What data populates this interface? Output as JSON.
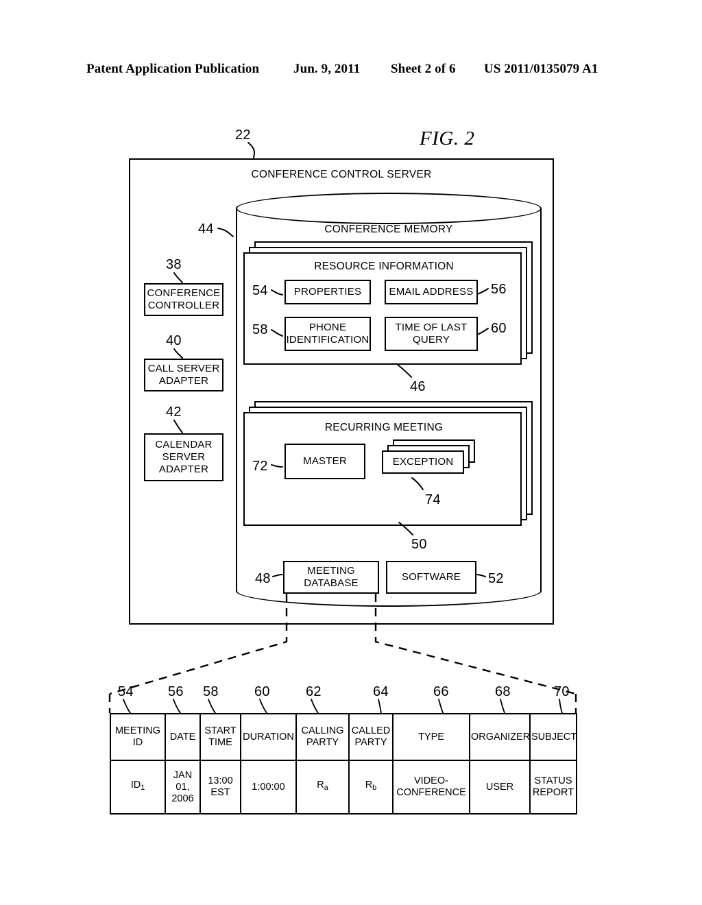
{
  "header": {
    "publication": "Patent Application Publication",
    "date": "Jun. 9, 2011",
    "sheet": "Sheet 2 of 6",
    "doc_number": "US 2011/0135079 A1"
  },
  "figure": {
    "title": "FIG. 2",
    "server": {
      "label": "CONFERENCE CONTROL SERVER",
      "ref": "22"
    },
    "memory": {
      "label": "CONFERENCE MEMORY",
      "ref": "44"
    },
    "side_boxes": [
      {
        "label": "CONFERENCE\nCONTROLLER",
        "ref": "38"
      },
      {
        "label": "CALL SERVER\nADAPTER",
        "ref": "40"
      },
      {
        "label": "CALENDAR\nSERVER\nADAPTER",
        "ref": "42"
      }
    ],
    "resource_information": {
      "label": "RESOURCE INFORMATION",
      "ref": "46",
      "cells": [
        {
          "label": "PROPERTIES",
          "ref": "54"
        },
        {
          "label": "EMAIL ADDRESS",
          "ref": "56"
        },
        {
          "label": "PHONE\nIDENTIFICATION",
          "ref": "58"
        },
        {
          "label": "TIME OF LAST\nQUERY",
          "ref": "60"
        }
      ]
    },
    "recurring_meeting": {
      "label": "RECURRING MEETING",
      "ref": "50",
      "cells": [
        {
          "label": "MASTER",
          "ref": "72"
        },
        {
          "label": "EXCEPTION",
          "ref": "74"
        }
      ]
    },
    "bottom_boxes": [
      {
        "label": "MEETING\nDATABASE",
        "ref": "48"
      },
      {
        "label": "SOFTWARE",
        "ref": "52"
      }
    ]
  },
  "table": {
    "column_refs": [
      "54",
      "56",
      "58",
      "60",
      "62",
      "64",
      "66",
      "68",
      "70"
    ],
    "headers": [
      "MEETING\nID",
      "DATE",
      "START\nTIME",
      "DURATION",
      "CALLING\nPARTY",
      "CALLED\nPARTY",
      "TYPE",
      "ORGANIZER",
      "SUBJECT"
    ],
    "rows": [
      {
        "meeting_id": "ID",
        "meeting_id_sub": "1",
        "date": "JAN\n01,\n2006",
        "start_time": "13:00\nEST",
        "duration": "1:00:00",
        "calling_party": "R",
        "calling_party_sub": "a",
        "called_party": "R",
        "called_party_sub": "b",
        "type": "VIDEO-\nCONFERENCE",
        "organizer": "USER",
        "subject": "STATUS\nREPORT"
      }
    ]
  },
  "colors": {
    "ink": "#000000",
    "paper": "#ffffff"
  }
}
